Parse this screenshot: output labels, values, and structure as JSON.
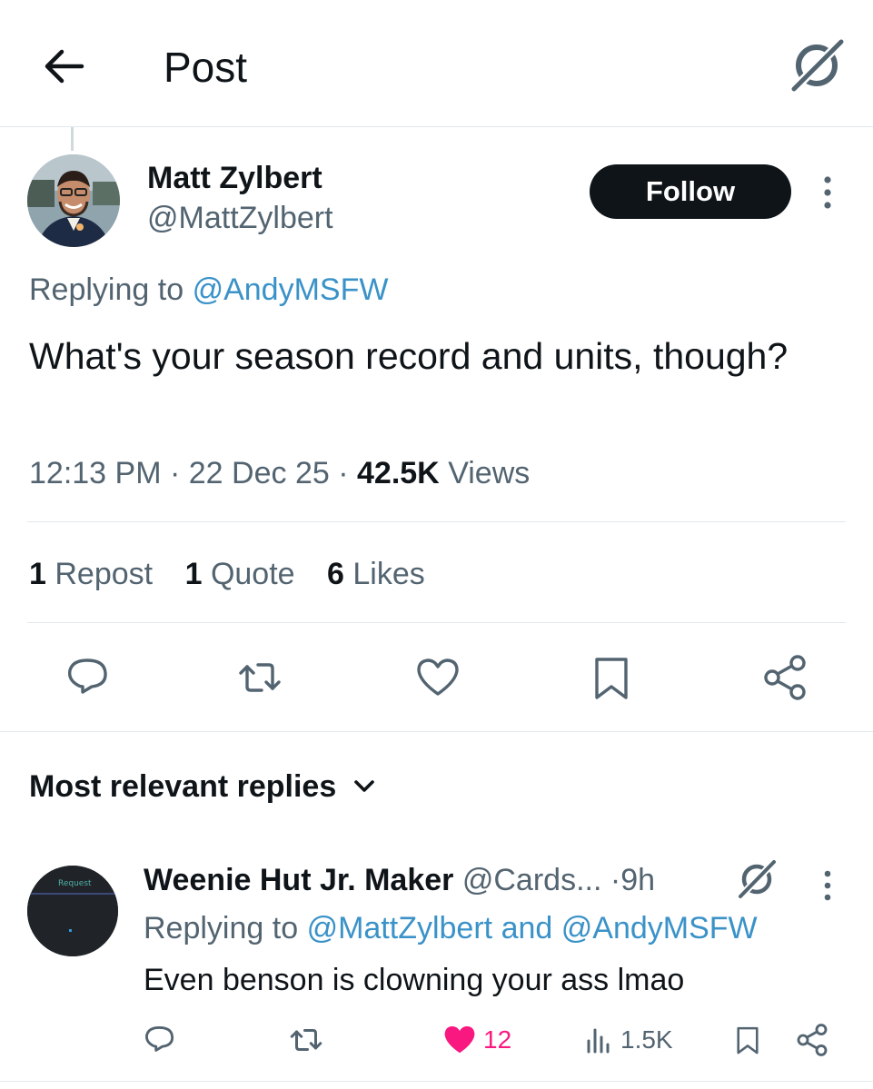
{
  "header": {
    "title": "Post"
  },
  "post": {
    "author_name": "Matt Zylbert",
    "author_handle": "@MattZylbert",
    "follow_label": "Follow",
    "replying_prefix": "Replying to",
    "replying_to": "@AndyMSFW",
    "text": "What's your season record and units, though?",
    "time": "12:13 PM",
    "date": "22 Dec 25",
    "views_count": "42.5K",
    "views_label": "Views",
    "stats": {
      "reposts_count": "1",
      "reposts_label": "Repost",
      "quotes_count": "1",
      "quotes_label": "Quote",
      "likes_count": "6",
      "likes_label": "Likes"
    }
  },
  "replies_section": {
    "sort_label": "Most relevant replies"
  },
  "reply": {
    "author_name": "Weenie Hut Jr. Maker",
    "author_handle": "@Cards...",
    "time": "9h",
    "avatar_text": "Request",
    "replying_prefix": "Replying to",
    "replying_to_1": "@MattZylbert",
    "replying_and": "and",
    "replying_to_2": "@AndyMSFW",
    "text": "Even benson is clowning your ass lmao",
    "likes": "12",
    "views": "1.5K"
  },
  "colors": {
    "text": "#0f1419",
    "secondary": "#536471",
    "link": "#1d9bf0",
    "like": "#f91880",
    "divider": "#e1e8ed"
  }
}
